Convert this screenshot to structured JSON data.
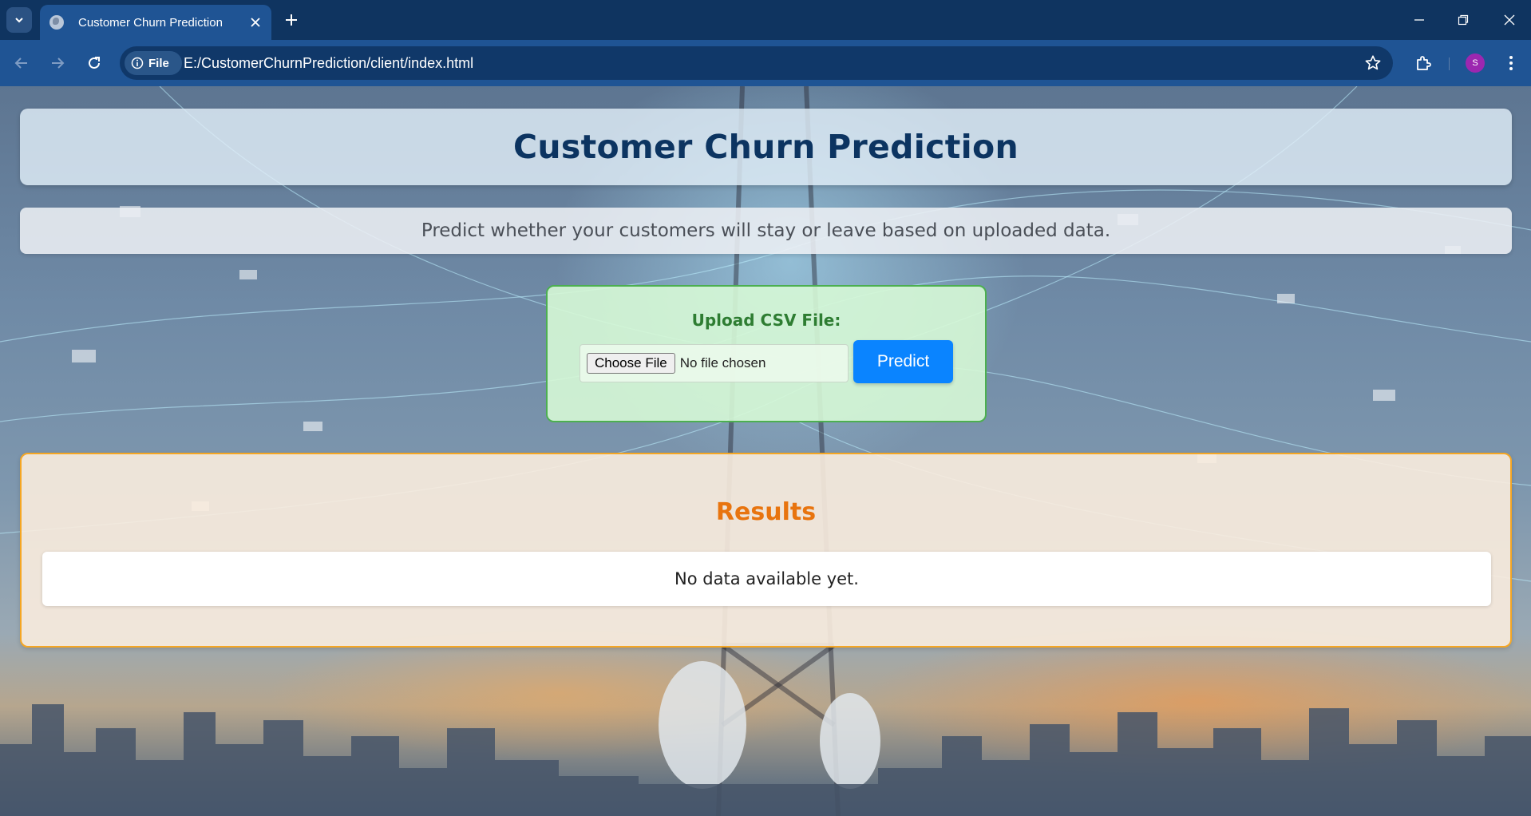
{
  "browser": {
    "tab_title": "Customer Churn Prediction",
    "site_chip": "File",
    "url": "E:/CustomerChurnPrediction/client/index.html",
    "profile_initial": "S",
    "colors": {
      "tabbar": "#0f3460",
      "toolbar": "#1f5494",
      "avatar": "#9c27b0"
    }
  },
  "page": {
    "title": "Customer Churn Prediction",
    "subtitle": "Predict whether your customers will stay or leave based on uploaded data."
  },
  "upload": {
    "label": "Upload CSV File:",
    "choose_button": "Choose File",
    "file_status": "No file chosen",
    "predict_button": "Predict",
    "colors": {
      "accent": "#2e7d32",
      "button": "#0a84ff"
    }
  },
  "results": {
    "title": "Results",
    "message": "No data available yet.",
    "colors": {
      "title": "#e8740f",
      "border": "#f5a623"
    }
  },
  "icons": [
    "tab-search-icon",
    "globe-icon",
    "close-icon",
    "plus-icon",
    "minimize-icon",
    "restore-icon",
    "window-close-icon",
    "back-arrow-icon",
    "forward-arrow-icon",
    "reload-icon",
    "info-icon",
    "star-icon",
    "extensions-icon",
    "more-vert-icon"
  ]
}
